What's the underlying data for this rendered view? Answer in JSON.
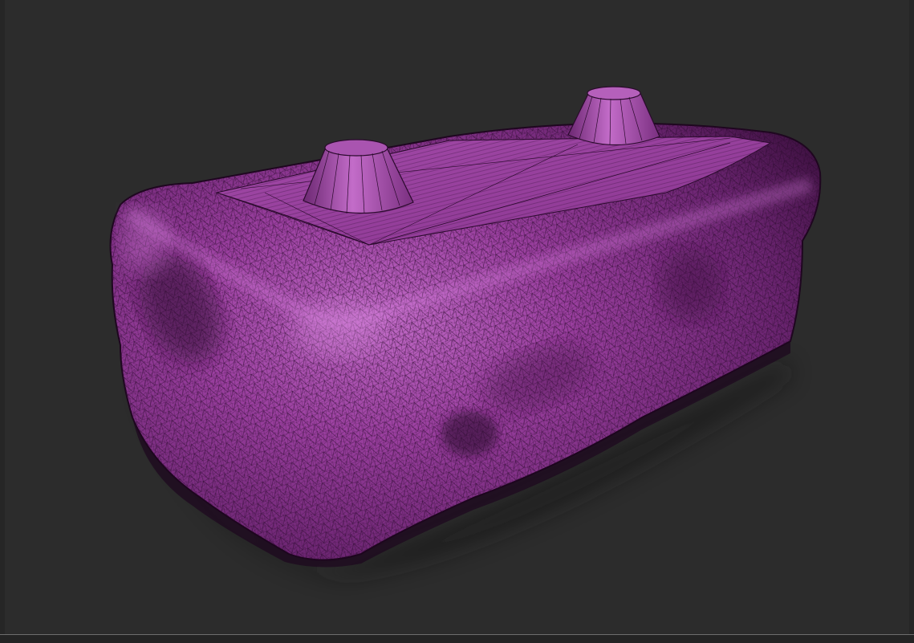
{
  "viewport": {
    "background_color": "#2c2c2c",
    "frame_color": "#6e6e6e"
  },
  "model": {
    "color": "#9c3fa0",
    "highlight_color": "#c86ad0",
    "shadow_color": "#3a0f3d",
    "wireframe_color": "#2a0a2c",
    "display_mode": "shaded-wireframe",
    "parts": [
      "rock-body",
      "top-cap-face",
      "peg-left",
      "peg-right"
    ]
  }
}
